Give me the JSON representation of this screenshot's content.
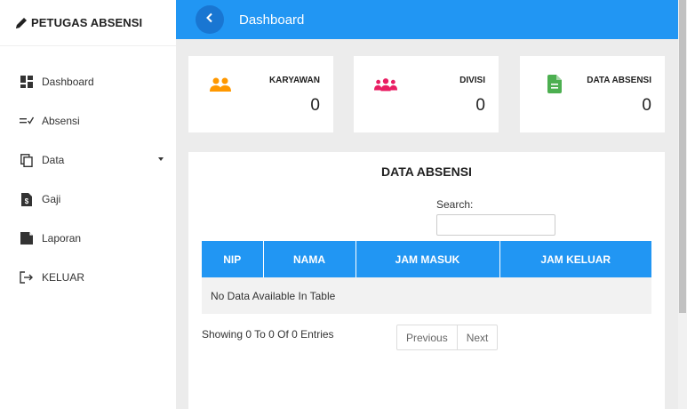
{
  "app": {
    "title": "PETUGAS ABSENSI",
    "icon": "pencil-icon"
  },
  "sidebar": {
    "items": [
      {
        "label": "Dashboard",
        "icon": "dashboard-grid-icon"
      },
      {
        "label": "Absensi",
        "icon": "checklist-icon"
      },
      {
        "label": "Data",
        "icon": "copy-pages-icon",
        "has_dropdown": true
      },
      {
        "label": "Gaji",
        "icon": "dollar-document-icon"
      },
      {
        "label": "Laporan",
        "icon": "report-document-icon"
      },
      {
        "label": "KELUAR",
        "icon": "logout-arrow-icon"
      }
    ]
  },
  "topbar": {
    "title": "Dashboard",
    "back_icon": "chevron-left-icon"
  },
  "cards": [
    {
      "label": "KARYAWAN",
      "value": "0",
      "icon": "users-icon",
      "color": "#ff9800"
    },
    {
      "label": "DIVISI",
      "value": "0",
      "icon": "users-group-icon",
      "color": "#e91e63"
    },
    {
      "label": "DATA ABSENSI",
      "value": "0",
      "icon": "file-text-icon",
      "color": "#4caf50"
    }
  ],
  "panel": {
    "title": "DATA ABSENSI",
    "search_label": "Search:",
    "search_value": "",
    "columns": [
      "NIP",
      "NAMA",
      "JAM MASUK",
      "JAM KELUAR"
    ],
    "empty_message": "No Data Available In Table",
    "entries_info": "Showing 0 To 0 Of 0 Entries",
    "pagination": {
      "previous": "Previous",
      "next": "Next"
    }
  },
  "colors": {
    "primary": "#2196f3",
    "primary_dark": "#1976d2",
    "background": "#ececec",
    "orange": "#ff9800",
    "pink": "#e91e63",
    "green": "#4caf50"
  }
}
